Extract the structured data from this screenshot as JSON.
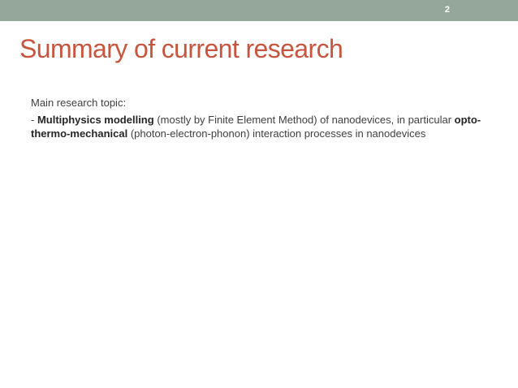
{
  "header": {
    "slide_number": "2",
    "bar_color": "#95a79a"
  },
  "slide": {
    "title": "Summary of current research",
    "title_color": "#c8553d",
    "intro": "Main research topic:",
    "bullet": {
      "prefix": "- ",
      "term1": "Multiphysics modelling",
      "text1": " (mostly by Finite Element Method) of nanodevices, in particular ",
      "term2": "opto-thermo-mechanical",
      "text2": " (photon-electron-phonon) interaction processes in nanodevices"
    }
  }
}
